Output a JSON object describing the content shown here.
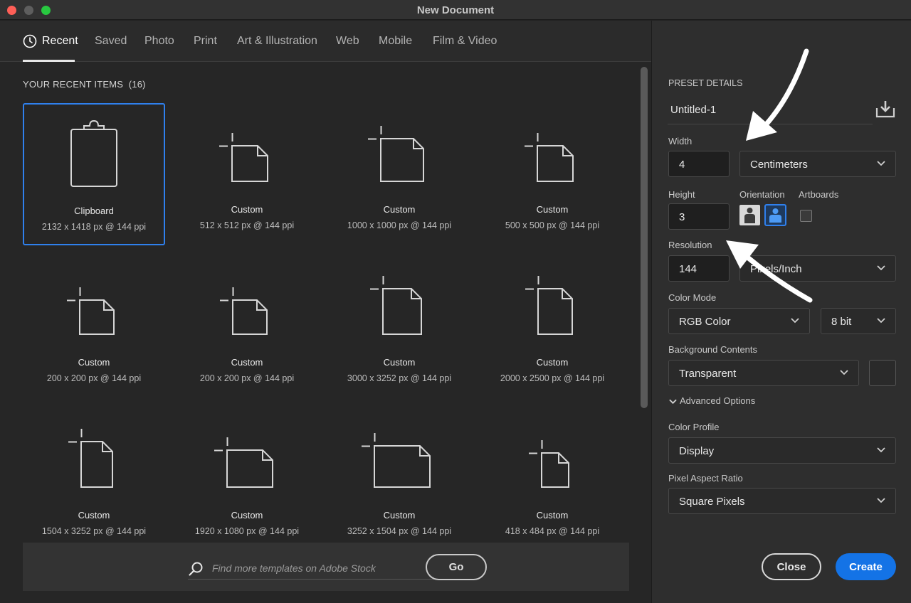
{
  "window": {
    "title": "New Document"
  },
  "tabs": [
    {
      "label": "Recent",
      "active": true
    },
    {
      "label": "Saved"
    },
    {
      "label": "Photo"
    },
    {
      "label": "Print"
    },
    {
      "label": "Art & Illustration"
    },
    {
      "label": "Web"
    },
    {
      "label": "Mobile"
    },
    {
      "label": "Film & Video"
    }
  ],
  "recent": {
    "title": "YOUR RECENT ITEMS",
    "count": "(16)",
    "items": [
      {
        "name": "Clipboard",
        "dims": "2132 x 1418 px @ 144 ppi",
        "icon": "clipboard-icon",
        "selected": true
      },
      {
        "name": "Custom",
        "dims": "512 x 512 px @ 144 ppi",
        "icon": "document-icon"
      },
      {
        "name": "Custom",
        "dims": "1000 x 1000 px @ 144 ppi",
        "icon": "document-icon"
      },
      {
        "name": "Custom",
        "dims": "500 x 500 px @ 144 ppi",
        "icon": "document-icon"
      },
      {
        "name": "Custom",
        "dims": "200 x 200 px @ 144 ppi",
        "icon": "document-icon"
      },
      {
        "name": "Custom",
        "dims": "200 x 200 px @ 144 ppi",
        "icon": "document-icon"
      },
      {
        "name": "Custom",
        "dims": "3000 x 3252 px @ 144 ppi",
        "icon": "document-icon"
      },
      {
        "name": "Custom",
        "dims": "2000 x 2500 px @ 144 ppi",
        "icon": "document-icon"
      },
      {
        "name": "Custom",
        "dims": "1504 x 3252 px @ 144 ppi",
        "icon": "document-icon"
      },
      {
        "name": "Custom",
        "dims": "1920 x 1080 px @ 144 ppi",
        "icon": "document-icon"
      },
      {
        "name": "Custom",
        "dims": "3252 x 1504 px @ 144 ppi",
        "icon": "document-icon"
      },
      {
        "name": "Custom",
        "dims": "418 x 484 px @ 144 ppi",
        "icon": "document-icon"
      }
    ]
  },
  "stock": {
    "placeholder": "Find more templates on Adobe Stock",
    "go_label": "Go"
  },
  "preset": {
    "section_title": "PRESET DETAILS",
    "doc_name": "Untitled-1",
    "width_label": "Width",
    "width_value": "4",
    "width_unit": "Centimeters",
    "height_label": "Height",
    "height_value": "3",
    "orientation_label": "Orientation",
    "artboards_label": "Artboards",
    "resolution_label": "Resolution",
    "resolution_value": "144",
    "resolution_unit": "Pixels/Inch",
    "color_mode_label": "Color Mode",
    "color_mode": "RGB Color",
    "bit_depth": "8 bit",
    "bg_label": "Background Contents",
    "bg_value": "Transparent",
    "advanced_label": "Advanced Options",
    "profile_label": "Color Profile",
    "profile_value": "Display",
    "par_label": "Pixel Aspect Ratio",
    "par_value": "Square Pixels"
  },
  "buttons": {
    "close": "Close",
    "create": "Create"
  },
  "colors": {
    "accent": "#1473e6",
    "selection": "#2f80ed",
    "background": "#262626",
    "panel": "#2e2e2e"
  }
}
